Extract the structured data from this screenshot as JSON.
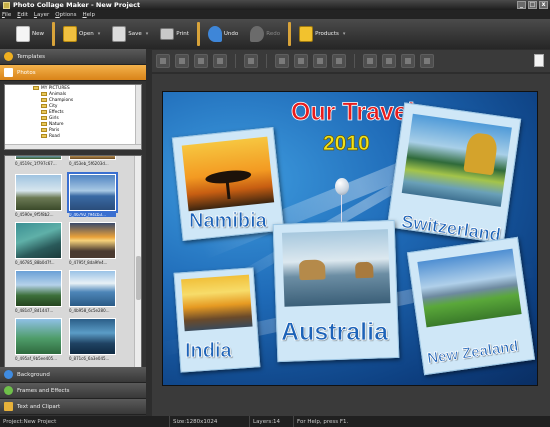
{
  "window": {
    "title": "Photo Collage Maker - New Project",
    "controls": [
      "_",
      "□",
      "x"
    ]
  },
  "menu": [
    "File",
    "Edit",
    "Layer",
    "Options",
    "Help"
  ],
  "toolbar": {
    "new": "New",
    "open": "Open",
    "save": "Save",
    "print": "Print",
    "undo": "Undo",
    "redo": "Redo",
    "products": "Products"
  },
  "left_panel": {
    "templates": "Templates",
    "photos": "Photos",
    "tree": [
      "MY PICTURES",
      "Animals",
      "Champions",
      "City",
      "Effects",
      "Girls",
      "Nature",
      "Paris",
      "Road"
    ],
    "thumbnails": [
      "0_4519c_1f797c67...",
      "0_453eb_5f6203d...",
      "0_4590e_9f5f8b2...",
      "0_46792_f94cb3...",
      "0_46785_88b0d7f...",
      "0_4795f_8da9fe4...",
      "0_481d7_8d1447...",
      "0_4b958_6c5e280...",
      "0_495af_9b5ee405...",
      "0_871c6_6a3e045..."
    ],
    "background": "Background",
    "frames": "Frames and Effects",
    "text": "Text and Clipart"
  },
  "collage": {
    "title": "Our Travels",
    "year": "2010",
    "photos": [
      {
        "label": "Namibia"
      },
      {
        "label": "Switzerland"
      },
      {
        "label": "Australia"
      },
      {
        "label": "India"
      },
      {
        "label": "New Zealand"
      }
    ]
  },
  "status": {
    "project": "Project:New Project",
    "size": "Size:1280x1024",
    "layers": "Layers:14",
    "help": "For Help, press F1."
  }
}
